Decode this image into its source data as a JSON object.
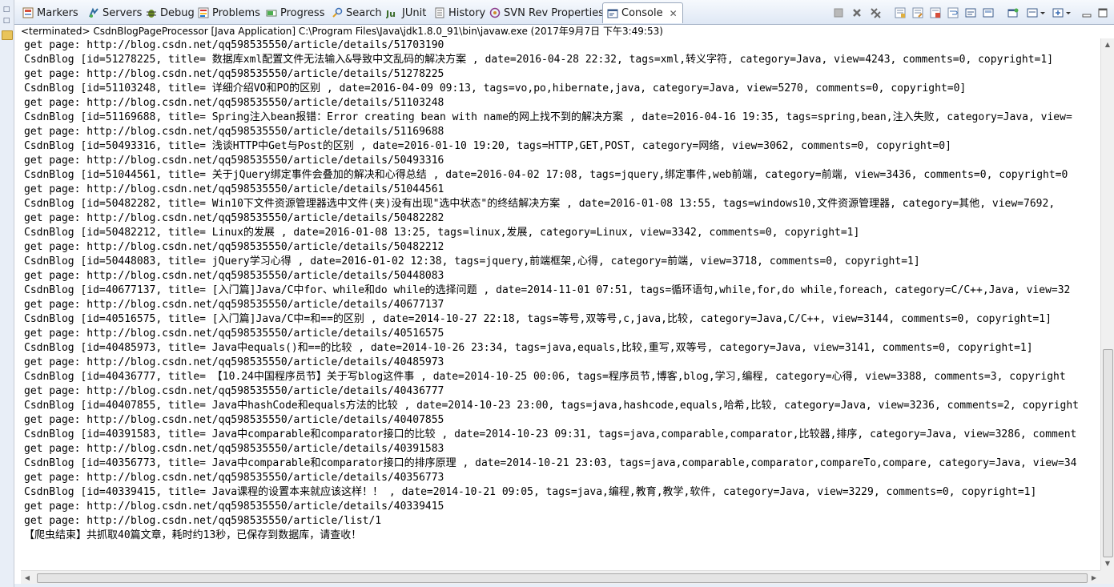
{
  "tabs": [
    {
      "label": "Markers",
      "icon": "markers-icon"
    },
    {
      "label": "Servers",
      "icon": "servers-icon"
    },
    {
      "label": "Debug",
      "icon": "debug-icon"
    },
    {
      "label": "Problems",
      "icon": "problems-icon"
    },
    {
      "label": "Progress",
      "icon": "progress-icon"
    },
    {
      "label": "Search",
      "icon": "search-icon"
    },
    {
      "label": "JUnit",
      "icon": "junit-icon"
    },
    {
      "label": "History",
      "icon": "history-icon"
    },
    {
      "label": "SVN Rev Properties",
      "icon": "svn-icon"
    },
    {
      "label": "Console",
      "icon": "console-icon",
      "active": true
    }
  ],
  "status_line": "<terminated> CsdnBlogPageProcessor [Java Application] C:\\Program Files\\Java\\jdk1.8.0_91\\bin\\javaw.exe (2017年9月7日 下午3:49:53)",
  "console_lines": [
    "get page: http://blog.csdn.net/qq598535550/article/details/51703190",
    "CsdnBlog [id=51278225, title= 数据库xml配置文件无法输入&导致中文乱码的解决方案 , date=2016-04-28 22:32, tags=xml,转义字符, category=Java, view=4243, comments=0, copyright=1]",
    "get page: http://blog.csdn.net/qq598535550/article/details/51278225",
    "CsdnBlog [id=51103248, title= 详细介绍VO和PO的区别 , date=2016-04-09 09:13, tags=vo,po,hibernate,java, category=Java, view=5270, comments=0, copyright=0]",
    "get page: http://blog.csdn.net/qq598535550/article/details/51103248",
    "CsdnBlog [id=51169688, title= Spring注入bean报错：Error creating bean with name的网上找不到的解决方案 , date=2016-04-16 19:35, tags=spring,bean,注入失败, category=Java, view=",
    "get page: http://blog.csdn.net/qq598535550/article/details/51169688",
    "CsdnBlog [id=50493316, title= 浅谈HTTP中Get与Post的区别 , date=2016-01-10 19:20, tags=HTTP,GET,POST, category=网络, view=3062, comments=0, copyright=0]",
    "get page: http://blog.csdn.net/qq598535550/article/details/50493316",
    "CsdnBlog [id=51044561, title= 关于jQuery绑定事件会叠加的解决和心得总结 , date=2016-04-02 17:08, tags=jquery,绑定事件,web前端, category=前端, view=3436, comments=0, copyright=0",
    "get page: http://blog.csdn.net/qq598535550/article/details/51044561",
    "CsdnBlog [id=50482282, title= Win10下文件资源管理器选中文件(夹)没有出现\"选中状态\"的终结解决方案 , date=2016-01-08 13:55, tags=windows10,文件资源管理器, category=其他, view=7692,",
    "get page: http://blog.csdn.net/qq598535550/article/details/50482282",
    "CsdnBlog [id=50482212, title= Linux的发展 , date=2016-01-08 13:25, tags=linux,发展, category=Linux, view=3342, comments=0, copyright=1]",
    "get page: http://blog.csdn.net/qq598535550/article/details/50482212",
    "CsdnBlog [id=50448083, title= jQuery学习心得 , date=2016-01-02 12:38, tags=jquery,前端框架,心得, category=前端, view=3718, comments=0, copyright=1]",
    "get page: http://blog.csdn.net/qq598535550/article/details/50448083",
    "CsdnBlog [id=40677137, title= [入门篇]Java/C中for、while和do while的选择问题 , date=2014-11-01 07:51, tags=循环语句,while,for,do while,foreach, category=C/C++,Java, view=32",
    "get page: http://blog.csdn.net/qq598535550/article/details/40677137",
    "CsdnBlog [id=40516575, title= [入门篇]Java/C中=和==的区别 , date=2014-10-27 22:18, tags=等号,双等号,c,java,比较, category=Java,C/C++, view=3144, comments=0, copyright=1]",
    "get page: http://blog.csdn.net/qq598535550/article/details/40516575",
    "CsdnBlog [id=40485973, title= Java中equals()和==的比较 , date=2014-10-26 23:34, tags=java,equals,比较,重写,双等号, category=Java, view=3141, comments=0, copyright=1]",
    "get page: http://blog.csdn.net/qq598535550/article/details/40485973",
    "CsdnBlog [id=40436777, title= 【10.24中国程序员节】关于写blog这件事 , date=2014-10-25 00:06, tags=程序员节,博客,blog,学习,编程, category=心得, view=3388, comments=3, copyright",
    "get page: http://blog.csdn.net/qq598535550/article/details/40436777",
    "CsdnBlog [id=40407855, title= Java中hashCode和equals方法的比较 , date=2014-10-23 23:00, tags=java,hashcode,equals,哈希,比较, category=Java, view=3236, comments=2, copyright",
    "get page: http://blog.csdn.net/qq598535550/article/details/40407855",
    "CsdnBlog [id=40391583, title= Java中comparable和comparator接口的比较 , date=2014-10-23 09:31, tags=java,comparable,comparator,比较器,排序, category=Java, view=3286, comment",
    "get page: http://blog.csdn.net/qq598535550/article/details/40391583",
    "CsdnBlog [id=40356773, title= Java中comparable和comparator接口的排序原理 , date=2014-10-21 23:03, tags=java,comparable,comparator,compareTo,compare, category=Java, view=34",
    "get page: http://blog.csdn.net/qq598535550/article/details/40356773",
    "CsdnBlog [id=40339415, title= Java课程的设置本来就应该这样！！ , date=2014-10-21 09:05, tags=java,编程,教育,教学,软件, category=Java, view=3229, comments=0, copyright=1]",
    "get page: http://blog.csdn.net/qq598535550/article/details/40339415",
    "get page: http://blog.csdn.net/qq598535550/article/list/1",
    "【爬虫结束】共抓取40篇文章，耗时约13秒，已保存到数据库，请查收！"
  ],
  "toolbar_icons": [
    "terminate-icon",
    "remove-launch-icon",
    "remove-all-terminated-icon",
    "scroll-lock-icon",
    "show-on-output-icon",
    "show-on-error-icon",
    "word-wrap-icon",
    "pin-console-icon",
    "display-selected-console-icon",
    "open-console-icon",
    "minimize-icon",
    "maximize-icon"
  ],
  "colors": {
    "tabbar_top": "#f6f9fd",
    "tabbar_bottom": "#dfe8f5",
    "console_text": "#000000"
  }
}
